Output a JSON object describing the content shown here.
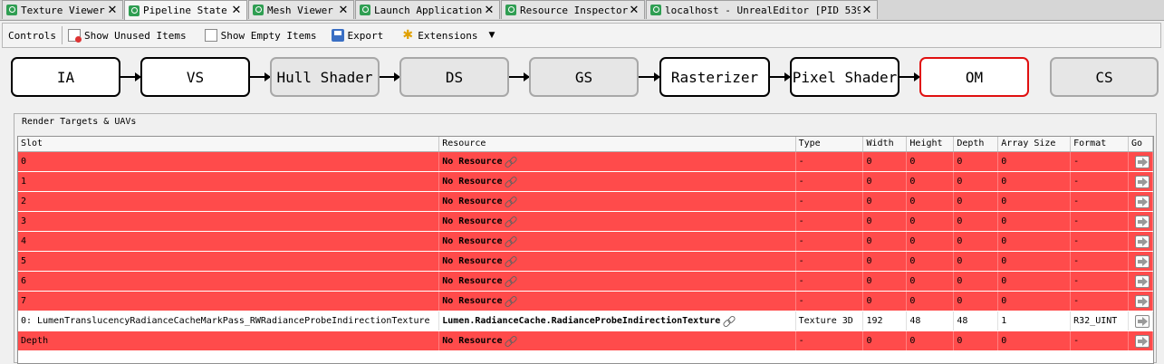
{
  "tabs": [
    {
      "label": "Texture Viewer",
      "active": false
    },
    {
      "label": "Pipeline State",
      "active": true
    },
    {
      "label": "Mesh Viewer",
      "active": false
    },
    {
      "label": "Launch Application",
      "active": false
    },
    {
      "label": "Resource Inspector",
      "active": false
    },
    {
      "label": "localhost - UnrealEditor [PID 539…",
      "active": false
    }
  ],
  "tab_close_glyph": "✕",
  "toolbar": {
    "controls_label": "Controls",
    "show_unused_label": "Show Unused Items",
    "show_empty_label": "Show Empty Items",
    "export_label": "Export",
    "extensions_label": "Extensions",
    "dropdown_glyph": "▼"
  },
  "pipeline": {
    "stages": [
      {
        "label": "IA",
        "state": "active"
      },
      {
        "label": "VS",
        "state": "active"
      },
      {
        "label": "Hull Shader",
        "state": "inactive"
      },
      {
        "label": "DS",
        "state": "inactive"
      },
      {
        "label": "GS",
        "state": "inactive"
      },
      {
        "label": "Rasterizer",
        "state": "active"
      },
      {
        "label": "Pixel Shader",
        "state": "active"
      },
      {
        "label": "OM",
        "state": "selected"
      },
      {
        "label": "CS",
        "state": "inactive"
      }
    ]
  },
  "render_targets": {
    "title": "Render Targets & UAVs",
    "columns": [
      "Slot",
      "Resource",
      "Type",
      "Width",
      "Height",
      "Depth",
      "Array Size",
      "Format",
      "Go"
    ],
    "rows": [
      {
        "slot": "0",
        "resource": "No Resource",
        "type": "-",
        "width": "0",
        "height": "0",
        "depth": "0",
        "array_size": "0",
        "format": "-",
        "status": "missing"
      },
      {
        "slot": "1",
        "resource": "No Resource",
        "type": "-",
        "width": "0",
        "height": "0",
        "depth": "0",
        "array_size": "0",
        "format": "-",
        "status": "missing"
      },
      {
        "slot": "2",
        "resource": "No Resource",
        "type": "-",
        "width": "0",
        "height": "0",
        "depth": "0",
        "array_size": "0",
        "format": "-",
        "status": "missing"
      },
      {
        "slot": "3",
        "resource": "No Resource",
        "type": "-",
        "width": "0",
        "height": "0",
        "depth": "0",
        "array_size": "0",
        "format": "-",
        "status": "missing"
      },
      {
        "slot": "4",
        "resource": "No Resource",
        "type": "-",
        "width": "0",
        "height": "0",
        "depth": "0",
        "array_size": "0",
        "format": "-",
        "status": "missing"
      },
      {
        "slot": "5",
        "resource": "No Resource",
        "type": "-",
        "width": "0",
        "height": "0",
        "depth": "0",
        "array_size": "0",
        "format": "-",
        "status": "missing"
      },
      {
        "slot": "6",
        "resource": "No Resource",
        "type": "-",
        "width": "0",
        "height": "0",
        "depth": "0",
        "array_size": "0",
        "format": "-",
        "status": "missing"
      },
      {
        "slot": "7",
        "resource": "No Resource",
        "type": "-",
        "width": "0",
        "height": "0",
        "depth": "0",
        "array_size": "0",
        "format": "-",
        "status": "missing"
      },
      {
        "slot": "0: LumenTranslucencyRadianceCacheMarkPass_RWRadianceProbeIndirectionTexture",
        "resource": "Lumen.RadianceCache.RadianceProbeIndirectionTexture",
        "type": "Texture 3D",
        "width": "192",
        "height": "48",
        "depth": "48",
        "array_size": "1",
        "format": "R32_UINT",
        "status": "bound"
      },
      {
        "slot": "Depth",
        "resource": "No Resource",
        "type": "-",
        "width": "0",
        "height": "0",
        "depth": "0",
        "array_size": "0",
        "format": "-",
        "status": "missing"
      }
    ]
  },
  "colors": {
    "missing_row": "#ff4b4b",
    "selected_stage_border": "#e01010",
    "tab_icon": "#2f9e52"
  }
}
